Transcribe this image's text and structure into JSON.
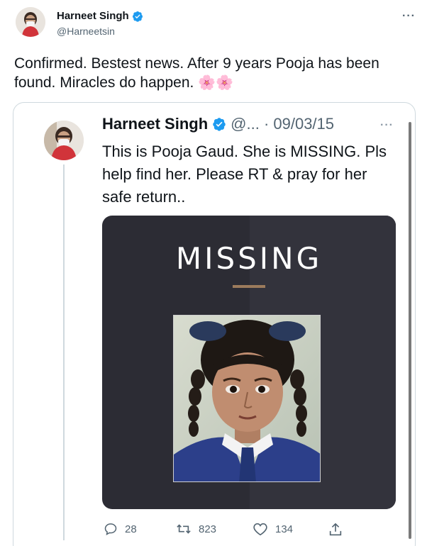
{
  "outer_tweet": {
    "author_name": "Harneet Singh",
    "handle": "@Harneetsin",
    "more_icon": "more-horizontal-icon",
    "text": "Confirmed. Bestest news. After 9 years Pooja has been found. Miracles do happen.",
    "emoji": "🌸🌸"
  },
  "quoted_tweet": {
    "author_name": "Harneet Singh",
    "handle_truncated": "@...",
    "date": "· 09/03/15",
    "more_icon": "more-horizontal-icon",
    "text": "This is Pooja Gaud. She is MISSING. Pls help find her. Please RT & pray for her safe return..",
    "image": {
      "title": "MISSING"
    },
    "actions": {
      "reply_count": "28",
      "retweet_count": "823",
      "like_count": "134"
    }
  },
  "colors": {
    "verified": "#1d9bf0",
    "text_primary": "#0f1419",
    "text_secondary": "#536471",
    "poster_bg": "#2c2c34",
    "poster_divider": "#9c7b5c"
  }
}
